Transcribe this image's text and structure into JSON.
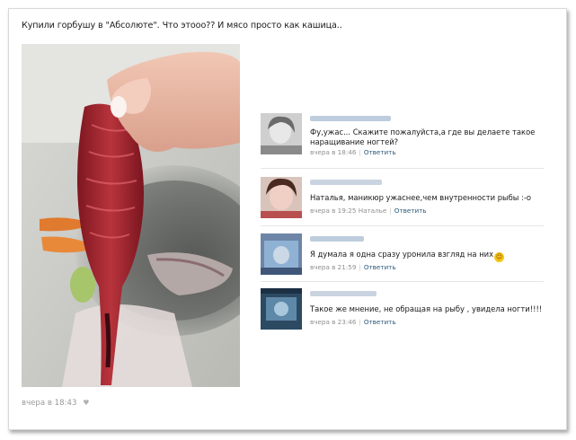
{
  "post": {
    "text": "Купили горбушу в \"Абсолюте\". Что этооо?? И мясо просто как кашица..",
    "time": "вчера в 18:43"
  },
  "comments": [
    {
      "text": "Фу,ужас... Скажите пожалуйста,а где вы делаете такое наращивание ногтей?",
      "time": "вчера в 18:46",
      "to": "",
      "reply": "Ответить",
      "author_color": "#a8bcd1"
    },
    {
      "text": "Наталья, маникюр ужаснее,чем внутренности рыбы :-o",
      "time": "вчера в 19:25",
      "to": "Наталье",
      "reply": "Ответить",
      "author_color": "#b7c6d6"
    },
    {
      "text": "Я думала я одна сразу уронила взгляд на них",
      "time": "вчера в 21:59",
      "to": "",
      "reply": "Ответить",
      "author_color": "#a8bcd1"
    },
    {
      "text": "Такое же мнение, не обращая на рыбу , увидела ногти!!!!",
      "time": "вчера в 23:46",
      "to": "",
      "reply": "Ответить",
      "author_color": "#b7c6d6"
    }
  ],
  "icons": {
    "like": "heart-icon",
    "emoji": "laughing-emoji-icon"
  }
}
